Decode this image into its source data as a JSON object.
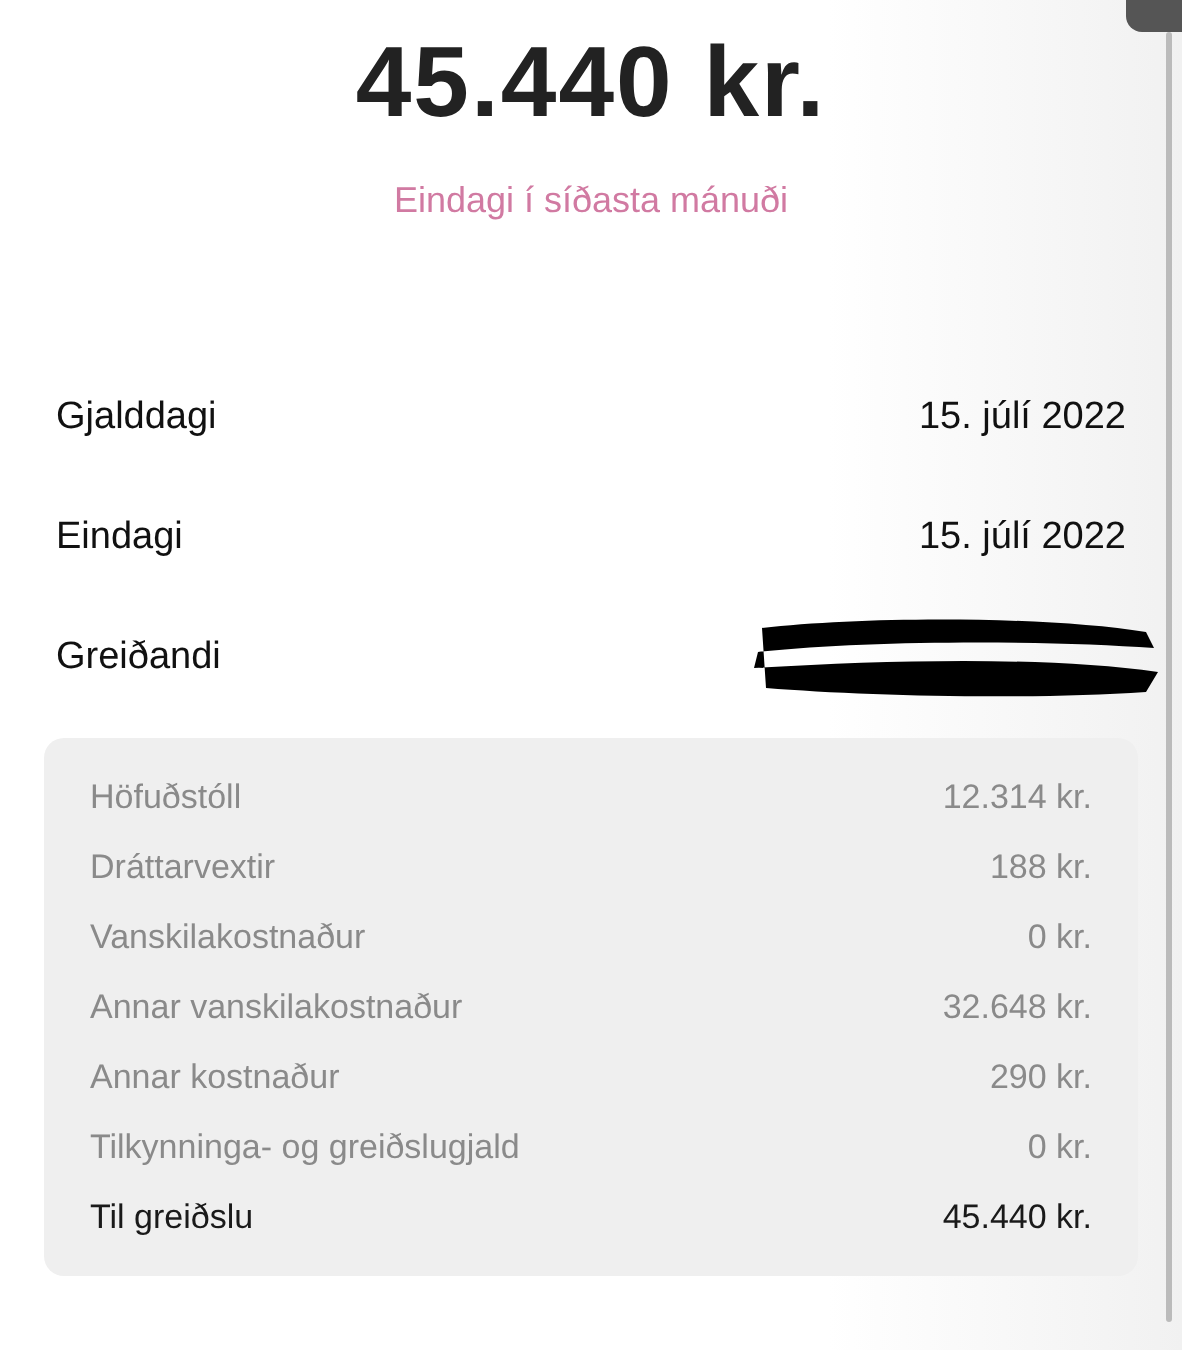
{
  "amount": "45.440 kr.",
  "due_status": "Eindagi í síðasta mánuði",
  "details": [
    {
      "label": "Gjalddagi",
      "value": "15. júlí 2022",
      "redacted": false
    },
    {
      "label": "Eindagi",
      "value": "15. júlí 2022",
      "redacted": false
    },
    {
      "label": "Greiðandi",
      "redacted": true
    }
  ],
  "breakdown": [
    {
      "kind": "item",
      "label": "Höfuðstóll",
      "value": "12.314 kr."
    },
    {
      "kind": "item",
      "label": "Dráttarvextir",
      "value": "188 kr."
    },
    {
      "kind": "item",
      "label": "Vanskilakostnaður",
      "value": "0 kr."
    },
    {
      "kind": "item",
      "label": "Annar vanskilakostnaður",
      "value": "32.648 kr."
    },
    {
      "kind": "item",
      "label": "Annar kostnaður",
      "value": "290 kr."
    },
    {
      "kind": "item",
      "label": "Tilkynninga- og greiðslugjald",
      "value": "0 kr."
    },
    {
      "kind": "total",
      "label": "Til greiðslu",
      "value": "45.440 kr."
    }
  ]
}
